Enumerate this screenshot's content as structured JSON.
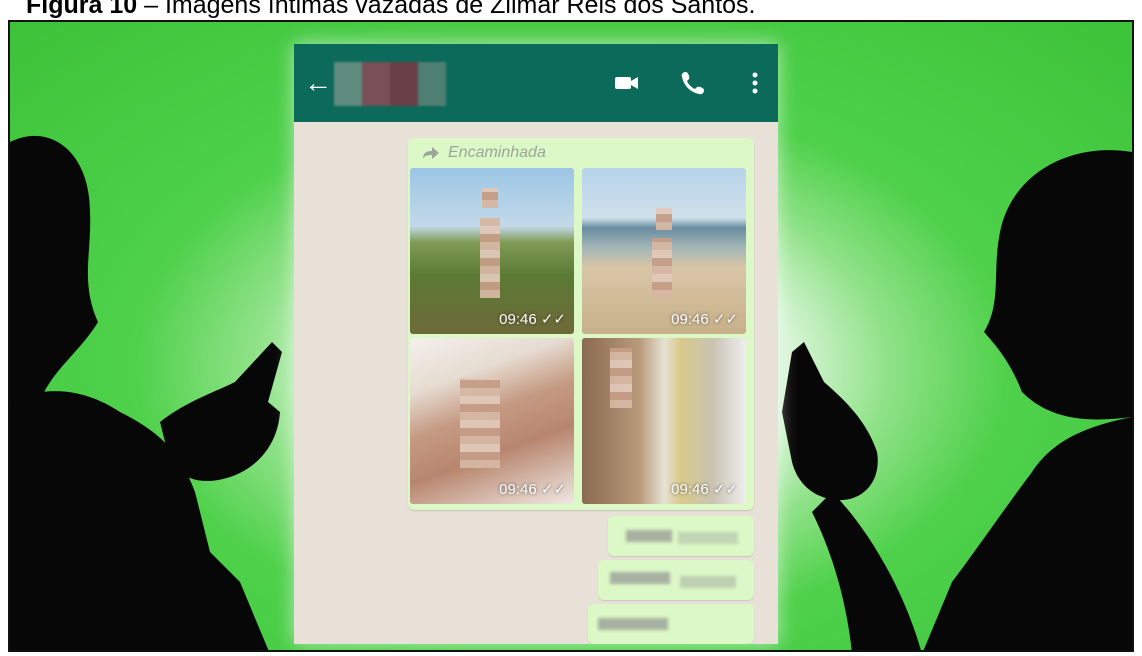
{
  "caption": {
    "label": "Figura 10",
    "text": " – Imagens íntimas vazadas de Zilmar Reis dos Santos."
  },
  "chat": {
    "forwarded_label": "Encaminhada",
    "photos": [
      {
        "time": "09:46"
      },
      {
        "time": "09:46"
      },
      {
        "time": "09:46"
      },
      {
        "time": "09:46"
      }
    ]
  },
  "colors": {
    "background_green": "#3cc33a",
    "header_teal": "#0b6a5a",
    "bubble_green": "#dcf8c6",
    "chat_background": "#e7e1d8"
  },
  "icons": [
    "back-arrow-icon",
    "video-call-icon",
    "phone-call-icon",
    "more-options-icon",
    "forward-icon",
    "double-check-icon"
  ]
}
